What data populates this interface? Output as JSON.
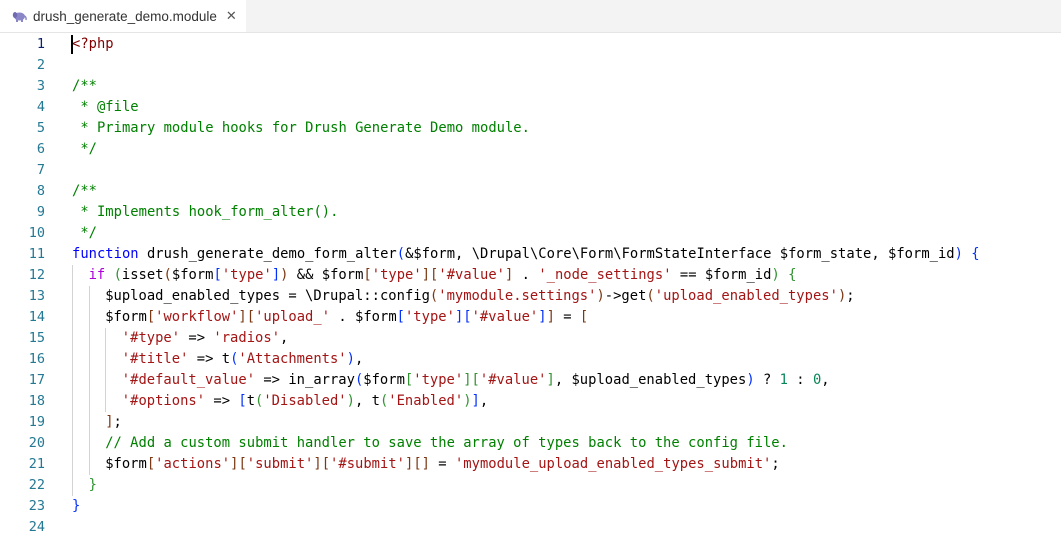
{
  "tab": {
    "filename": "drush_generate_demo.module",
    "icon": "php-elephant-icon",
    "close_icon": "close-icon"
  },
  "editor": {
    "active_line": 1,
    "lines": [
      {
        "n": "1",
        "indent": 0,
        "tokens": [
          {
            "t": "<?php",
            "c": "tag"
          }
        ]
      },
      {
        "n": "2",
        "indent": 0,
        "tokens": []
      },
      {
        "n": "3",
        "indent": 0,
        "tokens": [
          {
            "t": "/**",
            "c": "cm"
          }
        ]
      },
      {
        "n": "4",
        "indent": 0,
        "tokens": [
          {
            "t": " * @file",
            "c": "cm"
          }
        ]
      },
      {
        "n": "5",
        "indent": 0,
        "tokens": [
          {
            "t": " * Primary module hooks for Drush Generate Demo module.",
            "c": "cm"
          }
        ]
      },
      {
        "n": "6",
        "indent": 0,
        "tokens": [
          {
            "t": " */",
            "c": "cm"
          }
        ]
      },
      {
        "n": "7",
        "indent": 0,
        "tokens": []
      },
      {
        "n": "8",
        "indent": 0,
        "tokens": [
          {
            "t": "/**",
            "c": "cm"
          }
        ]
      },
      {
        "n": "9",
        "indent": 0,
        "tokens": [
          {
            "t": " * Implements hook_form_alter().",
            "c": "cm"
          }
        ]
      },
      {
        "n": "10",
        "indent": 0,
        "tokens": [
          {
            "t": " */",
            "c": "cm"
          }
        ]
      },
      {
        "n": "11",
        "indent": 0,
        "tokens": [
          {
            "t": "function",
            "c": "kw"
          },
          {
            "t": " drush_generate_demo_form_alter",
            "c": ""
          },
          {
            "t": "(",
            "c": "b1"
          },
          {
            "t": "&$form, \\Drupal\\Core\\Form\\FormStateInterface $form_state, $form_id",
            "c": ""
          },
          {
            "t": ")",
            "c": "b1"
          },
          {
            "t": " ",
            "c": ""
          },
          {
            "t": "{",
            "c": "b1"
          }
        ]
      },
      {
        "n": "12",
        "indent": 1,
        "tokens": [
          {
            "t": "if",
            "c": "ctrl"
          },
          {
            "t": " ",
            "c": ""
          },
          {
            "t": "(",
            "c": "b2"
          },
          {
            "t": "isset",
            "c": ""
          },
          {
            "t": "(",
            "c": "b3"
          },
          {
            "t": "$form",
            "c": ""
          },
          {
            "t": "[",
            "c": "b1"
          },
          {
            "t": "'type'",
            "c": "str"
          },
          {
            "t": "]",
            "c": "b1"
          },
          {
            "t": ")",
            "c": "b3"
          },
          {
            "t": " && $form",
            "c": ""
          },
          {
            "t": "[",
            "c": "b3"
          },
          {
            "t": "'type'",
            "c": "str"
          },
          {
            "t": "]",
            "c": "b3"
          },
          {
            "t": "[",
            "c": "b3"
          },
          {
            "t": "'#value'",
            "c": "str"
          },
          {
            "t": "]",
            "c": "b3"
          },
          {
            "t": " . ",
            "c": ""
          },
          {
            "t": "'_node_settings'",
            "c": "str"
          },
          {
            "t": " == $form_id",
            "c": ""
          },
          {
            "t": ")",
            "c": "b2"
          },
          {
            "t": " ",
            "c": ""
          },
          {
            "t": "{",
            "c": "b2"
          }
        ]
      },
      {
        "n": "13",
        "indent": 2,
        "tokens": [
          {
            "t": "$upload_enabled_types = \\Drupal::config",
            "c": ""
          },
          {
            "t": "(",
            "c": "b3"
          },
          {
            "t": "'mymodule.settings'",
            "c": "str"
          },
          {
            "t": ")",
            "c": "b3"
          },
          {
            "t": "->get",
            "c": ""
          },
          {
            "t": "(",
            "c": "b3"
          },
          {
            "t": "'upload_enabled_types'",
            "c": "str"
          },
          {
            "t": ")",
            "c": "b3"
          },
          {
            "t": ";",
            "c": ""
          }
        ]
      },
      {
        "n": "14",
        "indent": 2,
        "tokens": [
          {
            "t": "$form",
            "c": ""
          },
          {
            "t": "[",
            "c": "b3"
          },
          {
            "t": "'workflow'",
            "c": "str"
          },
          {
            "t": "]",
            "c": "b3"
          },
          {
            "t": "[",
            "c": "b3"
          },
          {
            "t": "'upload_'",
            "c": "str"
          },
          {
            "t": " . $form",
            "c": ""
          },
          {
            "t": "[",
            "c": "b1"
          },
          {
            "t": "'type'",
            "c": "str"
          },
          {
            "t": "]",
            "c": "b1"
          },
          {
            "t": "[",
            "c": "b1"
          },
          {
            "t": "'#value'",
            "c": "str"
          },
          {
            "t": "]",
            "c": "b1"
          },
          {
            "t": "]",
            "c": "b3"
          },
          {
            "t": " = ",
            "c": ""
          },
          {
            "t": "[",
            "c": "b3"
          }
        ]
      },
      {
        "n": "15",
        "indent": 3,
        "tokens": [
          {
            "t": "'#type'",
            "c": "str"
          },
          {
            "t": " => ",
            "c": ""
          },
          {
            "t": "'radios'",
            "c": "str"
          },
          {
            "t": ",",
            "c": ""
          }
        ]
      },
      {
        "n": "16",
        "indent": 3,
        "tokens": [
          {
            "t": "'#title'",
            "c": "str"
          },
          {
            "t": " => t",
            "c": ""
          },
          {
            "t": "(",
            "c": "b1"
          },
          {
            "t": "'Attachments'",
            "c": "str"
          },
          {
            "t": ")",
            "c": "b1"
          },
          {
            "t": ",",
            "c": ""
          }
        ]
      },
      {
        "n": "17",
        "indent": 3,
        "tokens": [
          {
            "t": "'#default_value'",
            "c": "str"
          },
          {
            "t": " => in_array",
            "c": ""
          },
          {
            "t": "(",
            "c": "b1"
          },
          {
            "t": "$form",
            "c": ""
          },
          {
            "t": "[",
            "c": "b2"
          },
          {
            "t": "'type'",
            "c": "str"
          },
          {
            "t": "]",
            "c": "b2"
          },
          {
            "t": "[",
            "c": "b2"
          },
          {
            "t": "'#value'",
            "c": "str"
          },
          {
            "t": "]",
            "c": "b2"
          },
          {
            "t": ", $upload_enabled_types",
            "c": ""
          },
          {
            "t": ")",
            "c": "b1"
          },
          {
            "t": " ? ",
            "c": ""
          },
          {
            "t": "1",
            "c": "num"
          },
          {
            "t": " : ",
            "c": ""
          },
          {
            "t": "0",
            "c": "num"
          },
          {
            "t": ",",
            "c": ""
          }
        ]
      },
      {
        "n": "18",
        "indent": 3,
        "tokens": [
          {
            "t": "'#options'",
            "c": "str"
          },
          {
            "t": " => ",
            "c": ""
          },
          {
            "t": "[",
            "c": "b1"
          },
          {
            "t": "t",
            "c": ""
          },
          {
            "t": "(",
            "c": "b2"
          },
          {
            "t": "'Disabled'",
            "c": "str"
          },
          {
            "t": ")",
            "c": "b2"
          },
          {
            "t": ", t",
            "c": ""
          },
          {
            "t": "(",
            "c": "b2"
          },
          {
            "t": "'Enabled'",
            "c": "str"
          },
          {
            "t": ")",
            "c": "b2"
          },
          {
            "t": "]",
            "c": "b1"
          },
          {
            "t": ",",
            "c": ""
          }
        ]
      },
      {
        "n": "19",
        "indent": 2,
        "tokens": [
          {
            "t": "]",
            "c": "b3"
          },
          {
            "t": ";",
            "c": ""
          }
        ]
      },
      {
        "n": "20",
        "indent": 2,
        "tokens": [
          {
            "t": "// Add a custom submit handler to save the array of types back to the config file.",
            "c": "cm"
          }
        ]
      },
      {
        "n": "21",
        "indent": 2,
        "tokens": [
          {
            "t": "$form",
            "c": ""
          },
          {
            "t": "[",
            "c": "b3"
          },
          {
            "t": "'actions'",
            "c": "str"
          },
          {
            "t": "]",
            "c": "b3"
          },
          {
            "t": "[",
            "c": "b3"
          },
          {
            "t": "'submit'",
            "c": "str"
          },
          {
            "t": "]",
            "c": "b3"
          },
          {
            "t": "[",
            "c": "b3"
          },
          {
            "t": "'#submit'",
            "c": "str"
          },
          {
            "t": "]",
            "c": "b3"
          },
          {
            "t": "[",
            "c": "b3"
          },
          {
            "t": "]",
            "c": "b3"
          },
          {
            "t": " = ",
            "c": ""
          },
          {
            "t": "'mymodule_upload_enabled_types_submit'",
            "c": "str"
          },
          {
            "t": ";",
            "c": ""
          }
        ]
      },
      {
        "n": "22",
        "indent": 1,
        "tokens": [
          {
            "t": "}",
            "c": "b2"
          }
        ]
      },
      {
        "n": "23",
        "indent": 0,
        "tokens": [
          {
            "t": "}",
            "c": "b1"
          }
        ]
      },
      {
        "n": "24",
        "indent": 0,
        "tokens": []
      }
    ]
  }
}
